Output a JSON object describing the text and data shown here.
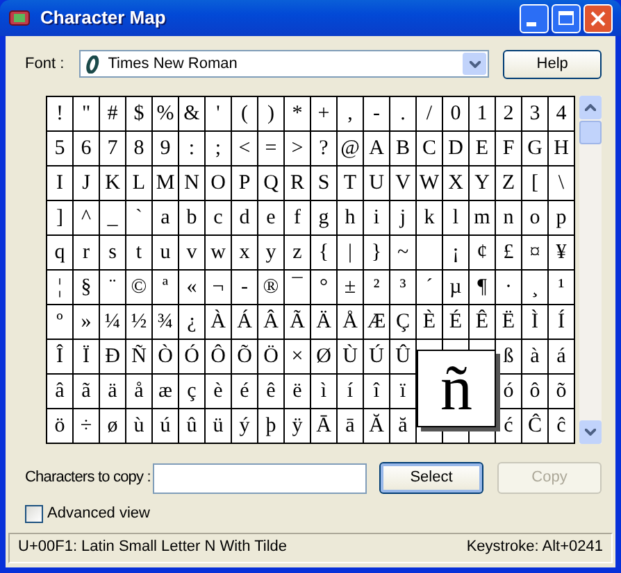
{
  "window": {
    "title": "Character Map"
  },
  "font": {
    "label": "Font :",
    "value": "Times New Roman"
  },
  "help_button": {
    "label": "Help"
  },
  "grid": {
    "rows": [
      [
        "!",
        "\"",
        "#",
        "$",
        "%",
        "&",
        "'",
        "(",
        ")",
        "*",
        "+",
        ",",
        "-",
        ".",
        "/",
        "0",
        "1",
        "2",
        "3",
        "4"
      ],
      [
        "5",
        "6",
        "7",
        "8",
        "9",
        ":",
        ";",
        "<",
        "=",
        ">",
        "?",
        "@",
        "A",
        "B",
        "C",
        "D",
        "E",
        "F",
        "G",
        "H"
      ],
      [
        "I",
        "J",
        "K",
        "L",
        "M",
        "N",
        "O",
        "P",
        "Q",
        "R",
        "S",
        "T",
        "U",
        "V",
        "W",
        "X",
        "Y",
        "Z",
        "[",
        "\\"
      ],
      [
        "]",
        "^",
        "_",
        "`",
        "a",
        "b",
        "c",
        "d",
        "e",
        "f",
        "g",
        "h",
        "i",
        "j",
        "k",
        "l",
        "m",
        "n",
        "o",
        "p"
      ],
      [
        "q",
        "r",
        "s",
        "t",
        "u",
        "v",
        "w",
        "x",
        "y",
        "z",
        "{",
        "|",
        "}",
        "~",
        null,
        "¡",
        "¢",
        "£",
        "¤",
        "¥"
      ],
      [
        "¦",
        "§",
        "¨",
        "©",
        "ª",
        "«",
        "¬",
        "-",
        "®",
        "¯",
        "°",
        "±",
        "²",
        "³",
        "´",
        "µ",
        "¶",
        "·",
        "¸",
        "¹"
      ],
      [
        "º",
        "»",
        "¼",
        "½",
        "¾",
        "¿",
        "À",
        "Á",
        "Â",
        "Ã",
        "Ä",
        "Å",
        "Æ",
        "Ç",
        "È",
        "É",
        "Ê",
        "Ë",
        "Ì",
        "Í"
      ],
      [
        "Î",
        "Ï",
        "Ð",
        "Ñ",
        "Ò",
        "Ó",
        "Ô",
        "Õ",
        "Ö",
        "×",
        "Ø",
        "Ù",
        "Ú",
        "Û",
        null,
        null,
        null,
        "ß",
        "à",
        "á"
      ],
      [
        "â",
        "ã",
        "ä",
        "å",
        "æ",
        "ç",
        "è",
        "é",
        "ê",
        "ë",
        "ì",
        "í",
        "î",
        "ï",
        null,
        null,
        null,
        "ó",
        "ô",
        "õ"
      ],
      [
        "ö",
        "÷",
        "ø",
        "ù",
        "ú",
        "û",
        "ü",
        "ý",
        "þ",
        "ÿ",
        "Ā",
        "ā",
        "Ă",
        "ă",
        null,
        null,
        null,
        "ć",
        "Ĉ",
        "ĉ"
      ]
    ]
  },
  "enlarged_char": "ñ",
  "copy_field": {
    "label": "Characters to copy :"
  },
  "buttons": [
    {
      "label": "Select",
      "disabled": false
    },
    {
      "label": "Copy",
      "disabled": true
    }
  ],
  "advanced_view": {
    "label": "Advanced view",
    "checked": false
  },
  "status_bar": {
    "character": "U+00F1: Latin Small Letter N With Tilde",
    "keystroke": "Keystroke: Alt+0241"
  }
}
